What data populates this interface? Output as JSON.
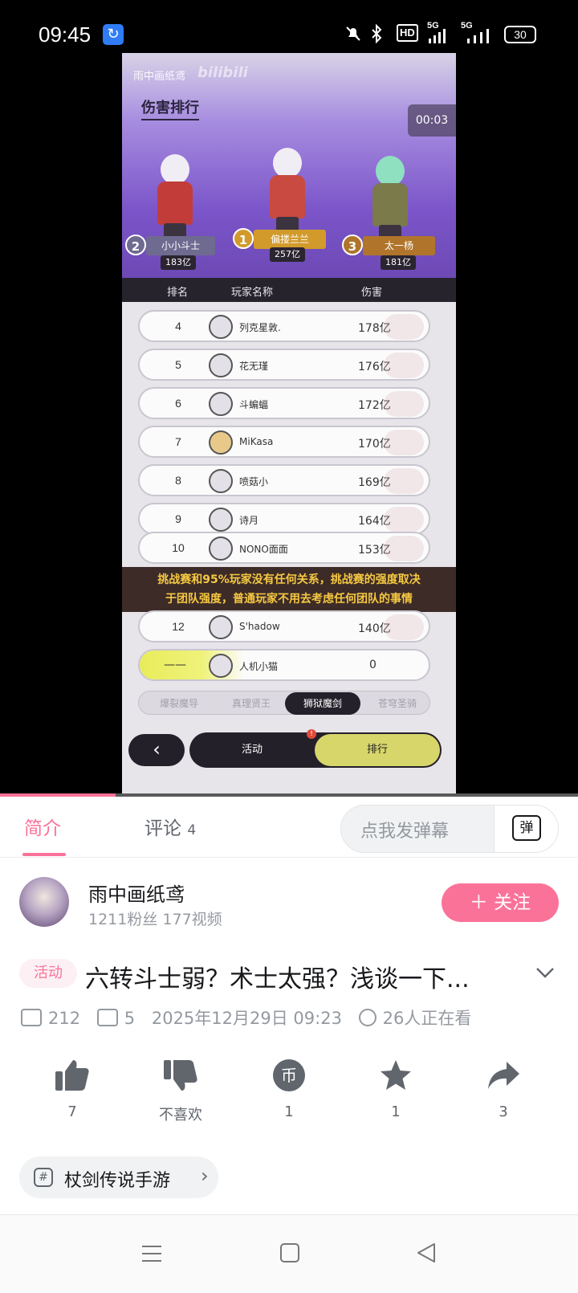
{
  "status_bar": {
    "time": "09:45",
    "network_hd": "HD",
    "network1": "5G",
    "network2": "5G",
    "battery": "30"
  },
  "game": {
    "watermark": "雨中画纸鸢",
    "watermark_logo": "bilibili",
    "title": "伤害排行",
    "timer": "00:03",
    "podium": [
      {
        "rank": "2",
        "name": "小小斗士",
        "score": "183亿"
      },
      {
        "rank": "1",
        "name": "偏搂兰兰",
        "score": "257亿"
      },
      {
        "rank": "3",
        "name": "太一杨",
        "score": "181亿"
      }
    ],
    "columns": {
      "rank": "排名",
      "name": "玩家名称",
      "damage": "伤害"
    },
    "rows": [
      {
        "rank": "4",
        "name": "列克星敦.",
        "damage": "178亿"
      },
      {
        "rank": "5",
        "name": "花无瑾",
        "damage": "176亿"
      },
      {
        "rank": "6",
        "name": "斗蝙蝠",
        "damage": "172亿"
      },
      {
        "rank": "7",
        "name": "MiKasa",
        "damage": "170亿"
      },
      {
        "rank": "8",
        "name": "喷菇小",
        "damage": "169亿"
      },
      {
        "rank": "9",
        "name": "诗月",
        "damage": "164亿"
      },
      {
        "rank": "10",
        "name": "NONO面面",
        "damage": "153亿"
      },
      {
        "rank": "12",
        "name": "S'hadow",
        "damage": "140亿"
      }
    ],
    "overlay_line1": "挑战赛和95%玩家没有任何关系，挑战赛的强度取决",
    "overlay_line2": "于团队强度，普通玩家不用去考虑任何团队的事情",
    "my_row": {
      "rank": "——",
      "name": "人机小猫",
      "damage": "0"
    },
    "class_tabs": [
      "爆裂魔导",
      "真理贤王",
      "狮狱魔剑",
      "苍穹圣骑"
    ],
    "bottom_tabs": {
      "activity": "活动",
      "ranking": "排行",
      "notice": "!"
    }
  },
  "video_progress": 0.2,
  "tabs": {
    "intro": "简介",
    "comments": "评论",
    "comments_count": "4",
    "danmaku_placeholder": "点我发弹幕",
    "danmaku_icon_char": "弹"
  },
  "uploader": {
    "name": "雨中画纸鸢",
    "stats": "1211粉丝   177视频",
    "follow": "＋ 关注"
  },
  "video": {
    "tag": "活动",
    "title": "六转斗士弱？术士太强？浅谈一下...",
    "views": "212",
    "danmaku": "5",
    "date": "2025年12月29日 09:23",
    "watching": "26人正在看"
  },
  "actions": {
    "like": "7",
    "dislike": "不喜欢",
    "coin": "1",
    "coin_char": "币",
    "favorite": "1",
    "share": "3"
  },
  "game_tag": {
    "icon": "#",
    "label": "杖剑传说手游",
    "chevron": "›"
  },
  "colors": {
    "accent": "#fb7299",
    "text_primary": "#18191c",
    "text_secondary": "#9499a0"
  }
}
